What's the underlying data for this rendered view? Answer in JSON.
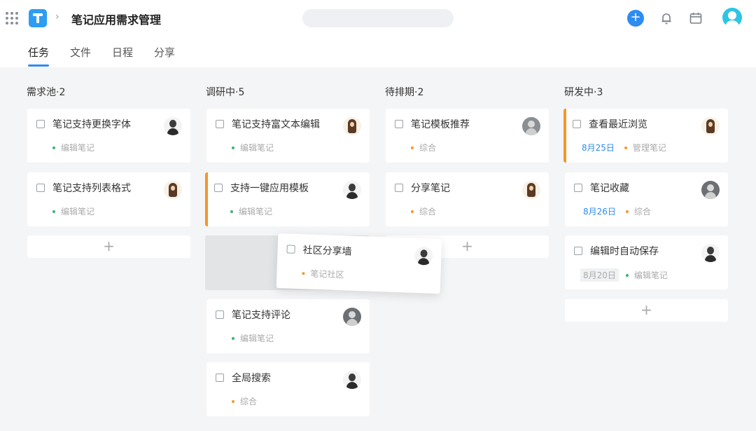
{
  "header": {
    "project_title": "笔记应用需求管理",
    "add_label": "+"
  },
  "tabs": [
    {
      "label": "任务",
      "active": true
    },
    {
      "label": "文件",
      "active": false
    },
    {
      "label": "日程",
      "active": false
    },
    {
      "label": "分享",
      "active": false
    }
  ],
  "colors": {
    "accent": "#2e8cf0",
    "flag": "#f5962b",
    "tag_green": "#3cb371",
    "tag_orange": "#f5962b"
  },
  "columns": [
    {
      "title": "需求池·2",
      "cards": [
        {
          "title": "笔记支持更换字体",
          "tag": "编辑笔记",
          "tag_color": "green",
          "avatar": "person"
        },
        {
          "title": "笔记支持列表格式",
          "tag": "编辑笔记",
          "tag_color": "green",
          "avatar": "female"
        }
      ],
      "add_label": "+"
    },
    {
      "title": "调研中·5",
      "cards": [
        {
          "title": "笔记支持富文本编辑",
          "tag": "编辑笔记",
          "tag_color": "green",
          "avatar": "female"
        },
        {
          "title": "支持一键应用模板",
          "tag": "编辑笔记",
          "tag_color": "green",
          "avatar": "person",
          "flagged": true
        },
        {
          "title": "笔记支持评论",
          "tag": "编辑笔记",
          "tag_color": "green",
          "avatar": "dark"
        },
        {
          "title": "全局搜索",
          "tag": "综合",
          "tag_color": "orange",
          "avatar": "person"
        }
      ]
    },
    {
      "title": "待排期·2",
      "cards": [
        {
          "title": "笔记模板推荐",
          "tag": "综合",
          "tag_color": "orange",
          "avatar": "grey"
        },
        {
          "title": "分享笔记",
          "tag": "综合",
          "tag_color": "orange",
          "avatar": "female"
        }
      ],
      "add_label": "+"
    },
    {
      "title": "研发中·3",
      "cards": [
        {
          "title": "查看最近浏览",
          "date": "8月25日",
          "tag": "管理笔记",
          "tag_color": "orange",
          "avatar": "female",
          "flagged": true
        },
        {
          "title": "笔记收藏",
          "date": "8月26日",
          "tag": "综合",
          "tag_color": "orange",
          "avatar": "dark"
        },
        {
          "title": "编辑时自动保存",
          "date": "8月20日",
          "tag": "编辑笔记",
          "tag_color": "green",
          "avatar": "person"
        }
      ],
      "add_label": "+"
    }
  ],
  "dragging_card": {
    "title": "社区分享墙",
    "tag": "笔记社区",
    "tag_color": "orange",
    "avatar": "person"
  }
}
